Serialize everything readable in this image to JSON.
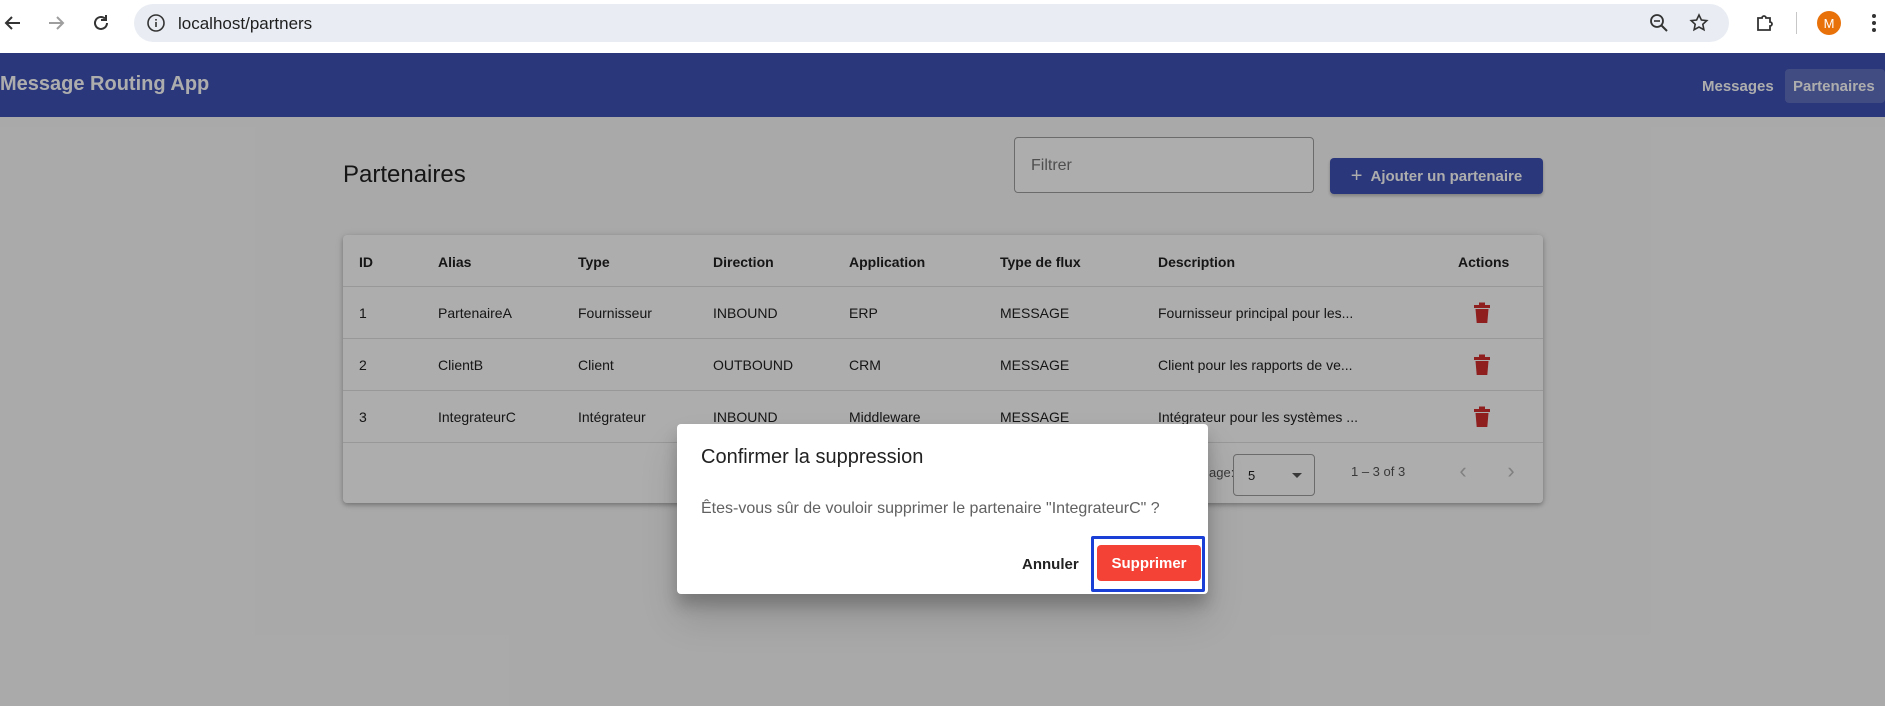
{
  "browser": {
    "url": "localhost/partners",
    "avatar_letter": "M"
  },
  "appbar": {
    "title": "Message Routing App",
    "nav": [
      {
        "label": "Messages",
        "active": false
      },
      {
        "label": "Partenaires",
        "active": true
      }
    ]
  },
  "page": {
    "title": "Partenaires",
    "filter_placeholder": "Filtrer",
    "add_button": "Ajouter un partenaire"
  },
  "table": {
    "columns": [
      "ID",
      "Alias",
      "Type",
      "Direction",
      "Application",
      "Type de flux",
      "Description",
      "Actions"
    ],
    "rows": [
      {
        "id": "1",
        "alias": "PartenaireA",
        "type": "Fournisseur",
        "direction": "INBOUND",
        "application": "ERP",
        "flow": "MESSAGE",
        "description": "Fournisseur principal pour les..."
      },
      {
        "id": "2",
        "alias": "ClientB",
        "type": "Client",
        "direction": "OUTBOUND",
        "application": "CRM",
        "flow": "MESSAGE",
        "description": "Client pour les rapports de ve..."
      },
      {
        "id": "3",
        "alias": "IntegrateurC",
        "type": "Intégrateur",
        "direction": "INBOUND",
        "application": "Middleware",
        "flow": "MESSAGE",
        "description": "Intégrateur pour les systèmes ..."
      }
    ]
  },
  "paginator": {
    "label": "age:",
    "page_size": "5",
    "range": "1 – 3 of 3"
  },
  "dialog": {
    "title": "Confirmer la suppression",
    "message": "Êtes-vous sûr de vouloir supprimer le partenaire \"IntegrateurC\" ?",
    "cancel": "Annuler",
    "confirm": "Supprimer"
  },
  "colors": {
    "primary": "#3f51b5",
    "warn": "#f44336",
    "delete_icon": "#d32f2f",
    "focus_ring": "#1a3fd6"
  },
  "icons": {
    "back": "arrow-left-icon",
    "forward": "arrow-right-icon",
    "reload": "reload-icon",
    "info": "info-icon",
    "zoom": "zoom-icon",
    "star": "star-icon",
    "extensions": "puzzle-icon",
    "menu": "kebab-menu-icon",
    "delete": "trash-icon"
  }
}
